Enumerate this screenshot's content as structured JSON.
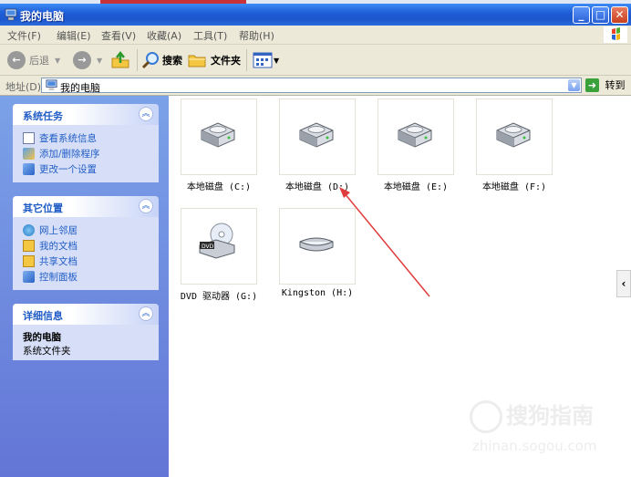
{
  "window": {
    "title": "我的电脑",
    "minimize": "_",
    "maximize": "□",
    "close": "✕"
  },
  "menu": [
    "文件(F)",
    "编辑(E)",
    "查看(V)",
    "收藏(A)",
    "工具(T)",
    "帮助(H)"
  ],
  "toolbar": {
    "back": "后退",
    "search": "搜索",
    "folders": "文件夹"
  },
  "address": {
    "label": "地址(D)",
    "value": "我的电脑",
    "go": "转到"
  },
  "panels": [
    {
      "title": "系统任务",
      "links": [
        "查看系统信息",
        "添加/删除程序",
        "更改一个设置"
      ]
    },
    {
      "title": "其它位置",
      "links": [
        "网上邻居",
        "我的文档",
        "共享文档",
        "控制面板"
      ]
    },
    {
      "title": "详细信息",
      "name": "我的电脑",
      "desc": "系统文件夹"
    }
  ],
  "drives": [
    {
      "label": "本地磁盘 (C:)",
      "icon": "hard-disk-icon"
    },
    {
      "label": "本地磁盘 (D:)",
      "icon": "hard-disk-icon"
    },
    {
      "label": "本地磁盘 (E:)",
      "icon": "hard-disk-icon"
    },
    {
      "label": "本地磁盘 (F:)",
      "icon": "hard-disk-icon"
    },
    {
      "label": "DVD 驱动器 (G:)",
      "icon": "dvd-drive-icon"
    },
    {
      "label": "Kingston (H:)",
      "icon": "removable-disk-icon"
    }
  ],
  "scroll_tab": "‹",
  "watermark": {
    "text": "搜狗指南",
    "url": "zhinan.sogou.com"
  },
  "colors": {
    "title_bar": "#1f5fd8",
    "sidebar": "#6f8fe0",
    "link": "#215dc6",
    "annotation_arrow": "#e03c3c"
  }
}
